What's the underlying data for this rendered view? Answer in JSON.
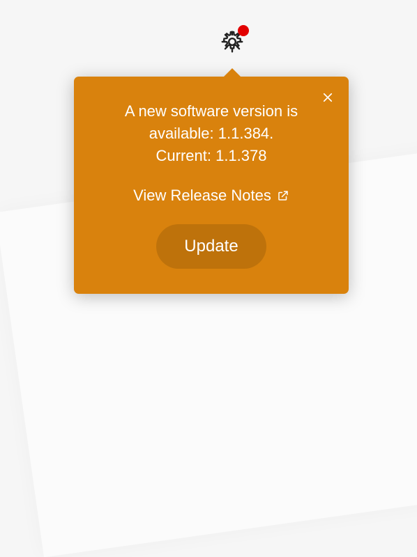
{
  "update_popover": {
    "message_line1": "A new software version is",
    "message_line2": "available: 1.1.384.",
    "message_line3": "Current: 1.1.378",
    "release_notes_label": "View Release Notes",
    "update_button_label": "Update"
  },
  "icons": {
    "gear": "gear-icon",
    "badge": "notification-dot",
    "close": "close-icon",
    "external": "external-link-icon"
  },
  "colors": {
    "popover_bg": "#d9820d",
    "badge": "#e20000",
    "text": "#ffffff"
  }
}
